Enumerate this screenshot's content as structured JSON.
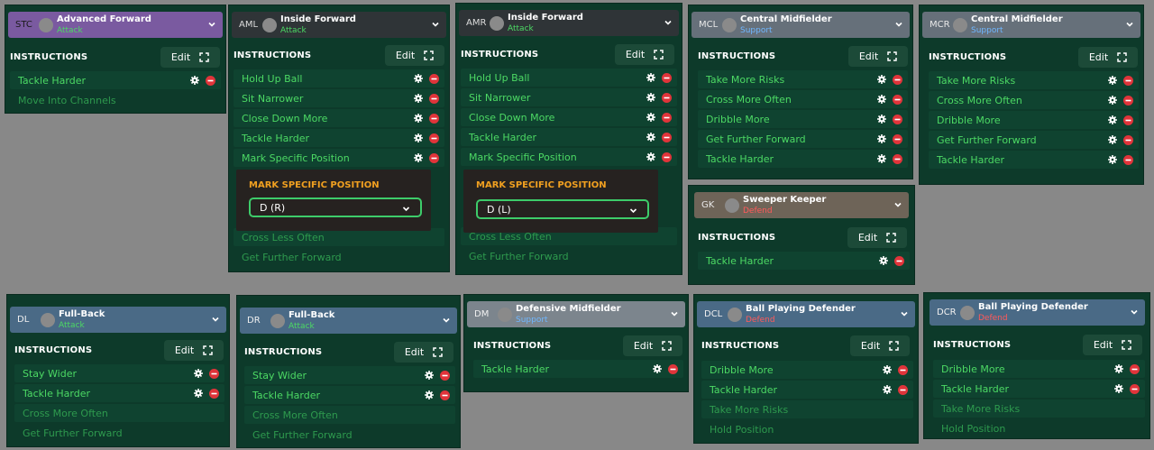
{
  "common": {
    "instructions_label": "INSTRUCTIONS",
    "edit_label": "Edit"
  },
  "cards": {
    "stc": {
      "pos": "STC",
      "role": "Advanced Forward",
      "duty": "Attack",
      "items": [
        "Tackle Harder",
        "Move Into Channels"
      ]
    },
    "aml": {
      "pos": "AML",
      "role": "Inside Forward",
      "duty": "Attack",
      "items": [
        "Hold Up Ball",
        "Sit Narrower",
        "Close Down More",
        "Tackle Harder",
        "Mark Specific Position",
        "Cross Less Often",
        "Get Further Forward"
      ],
      "popup": {
        "title": "MARK SPECIFIC POSITION",
        "value": "D (R)"
      }
    },
    "amr": {
      "pos": "AMR",
      "role": "Inside Forward",
      "duty": "Attack",
      "items": [
        "Hold Up Ball",
        "Sit Narrower",
        "Close Down More",
        "Tackle Harder",
        "Mark Specific Position",
        "Cross Less Often",
        "Get Further Forward"
      ],
      "popup": {
        "title": "MARK SPECIFIC POSITION",
        "value": "D (L)"
      }
    },
    "mcl": {
      "pos": "MCL",
      "role": "Central Midfielder",
      "duty": "Support",
      "items": [
        "Take More Risks",
        "Cross More Often",
        "Dribble More",
        "Get Further Forward",
        "Tackle Harder"
      ]
    },
    "mcr": {
      "pos": "MCR",
      "role": "Central Midfielder",
      "duty": "Support",
      "items": [
        "Take More Risks",
        "Cross More Often",
        "Dribble More",
        "Get Further Forward",
        "Tackle Harder"
      ]
    },
    "gk": {
      "pos": "GK",
      "role": "Sweeper Keeper",
      "duty": "Defend",
      "items": [
        "Tackle Harder"
      ]
    },
    "dl": {
      "pos": "DL",
      "role": "Full-Back",
      "duty": "Attack",
      "items": [
        "Stay Wider",
        "Tackle Harder",
        "Cross More Often",
        "Get Further Forward"
      ]
    },
    "dr": {
      "pos": "DR",
      "role": "Full-Back",
      "duty": "Attack",
      "items": [
        "Stay Wider",
        "Tackle Harder",
        "Cross More Often",
        "Get Further Forward"
      ]
    },
    "dm": {
      "pos": "DM",
      "role": "Defensive Midfielder",
      "duty": "Support",
      "items": [
        "Tackle Harder"
      ]
    },
    "dcl": {
      "pos": "DCL",
      "role": "Ball Playing Defender",
      "duty": "Defend",
      "items": [
        "Dribble More",
        "Tackle Harder",
        "Take More Risks",
        "Hold Position"
      ]
    },
    "dcr": {
      "pos": "DCR",
      "role": "Ball Playing Defender",
      "duty": "Defend",
      "items": [
        "Dribble More",
        "Tackle Harder",
        "Take More Risks",
        "Hold Position"
      ]
    }
  },
  "colors": {
    "background": "#888888",
    "panel": "#0d3a2a",
    "active_text": "#4cd964",
    "inactive_text": "#2e9a4e",
    "popup_title": "#f0a020",
    "remove_icon": "#e0343a"
  },
  "icons": {
    "settings": "gear-icon",
    "remove": "remove-icon",
    "expand": "expand-icon",
    "dropdown": "chevron-down-icon"
  }
}
